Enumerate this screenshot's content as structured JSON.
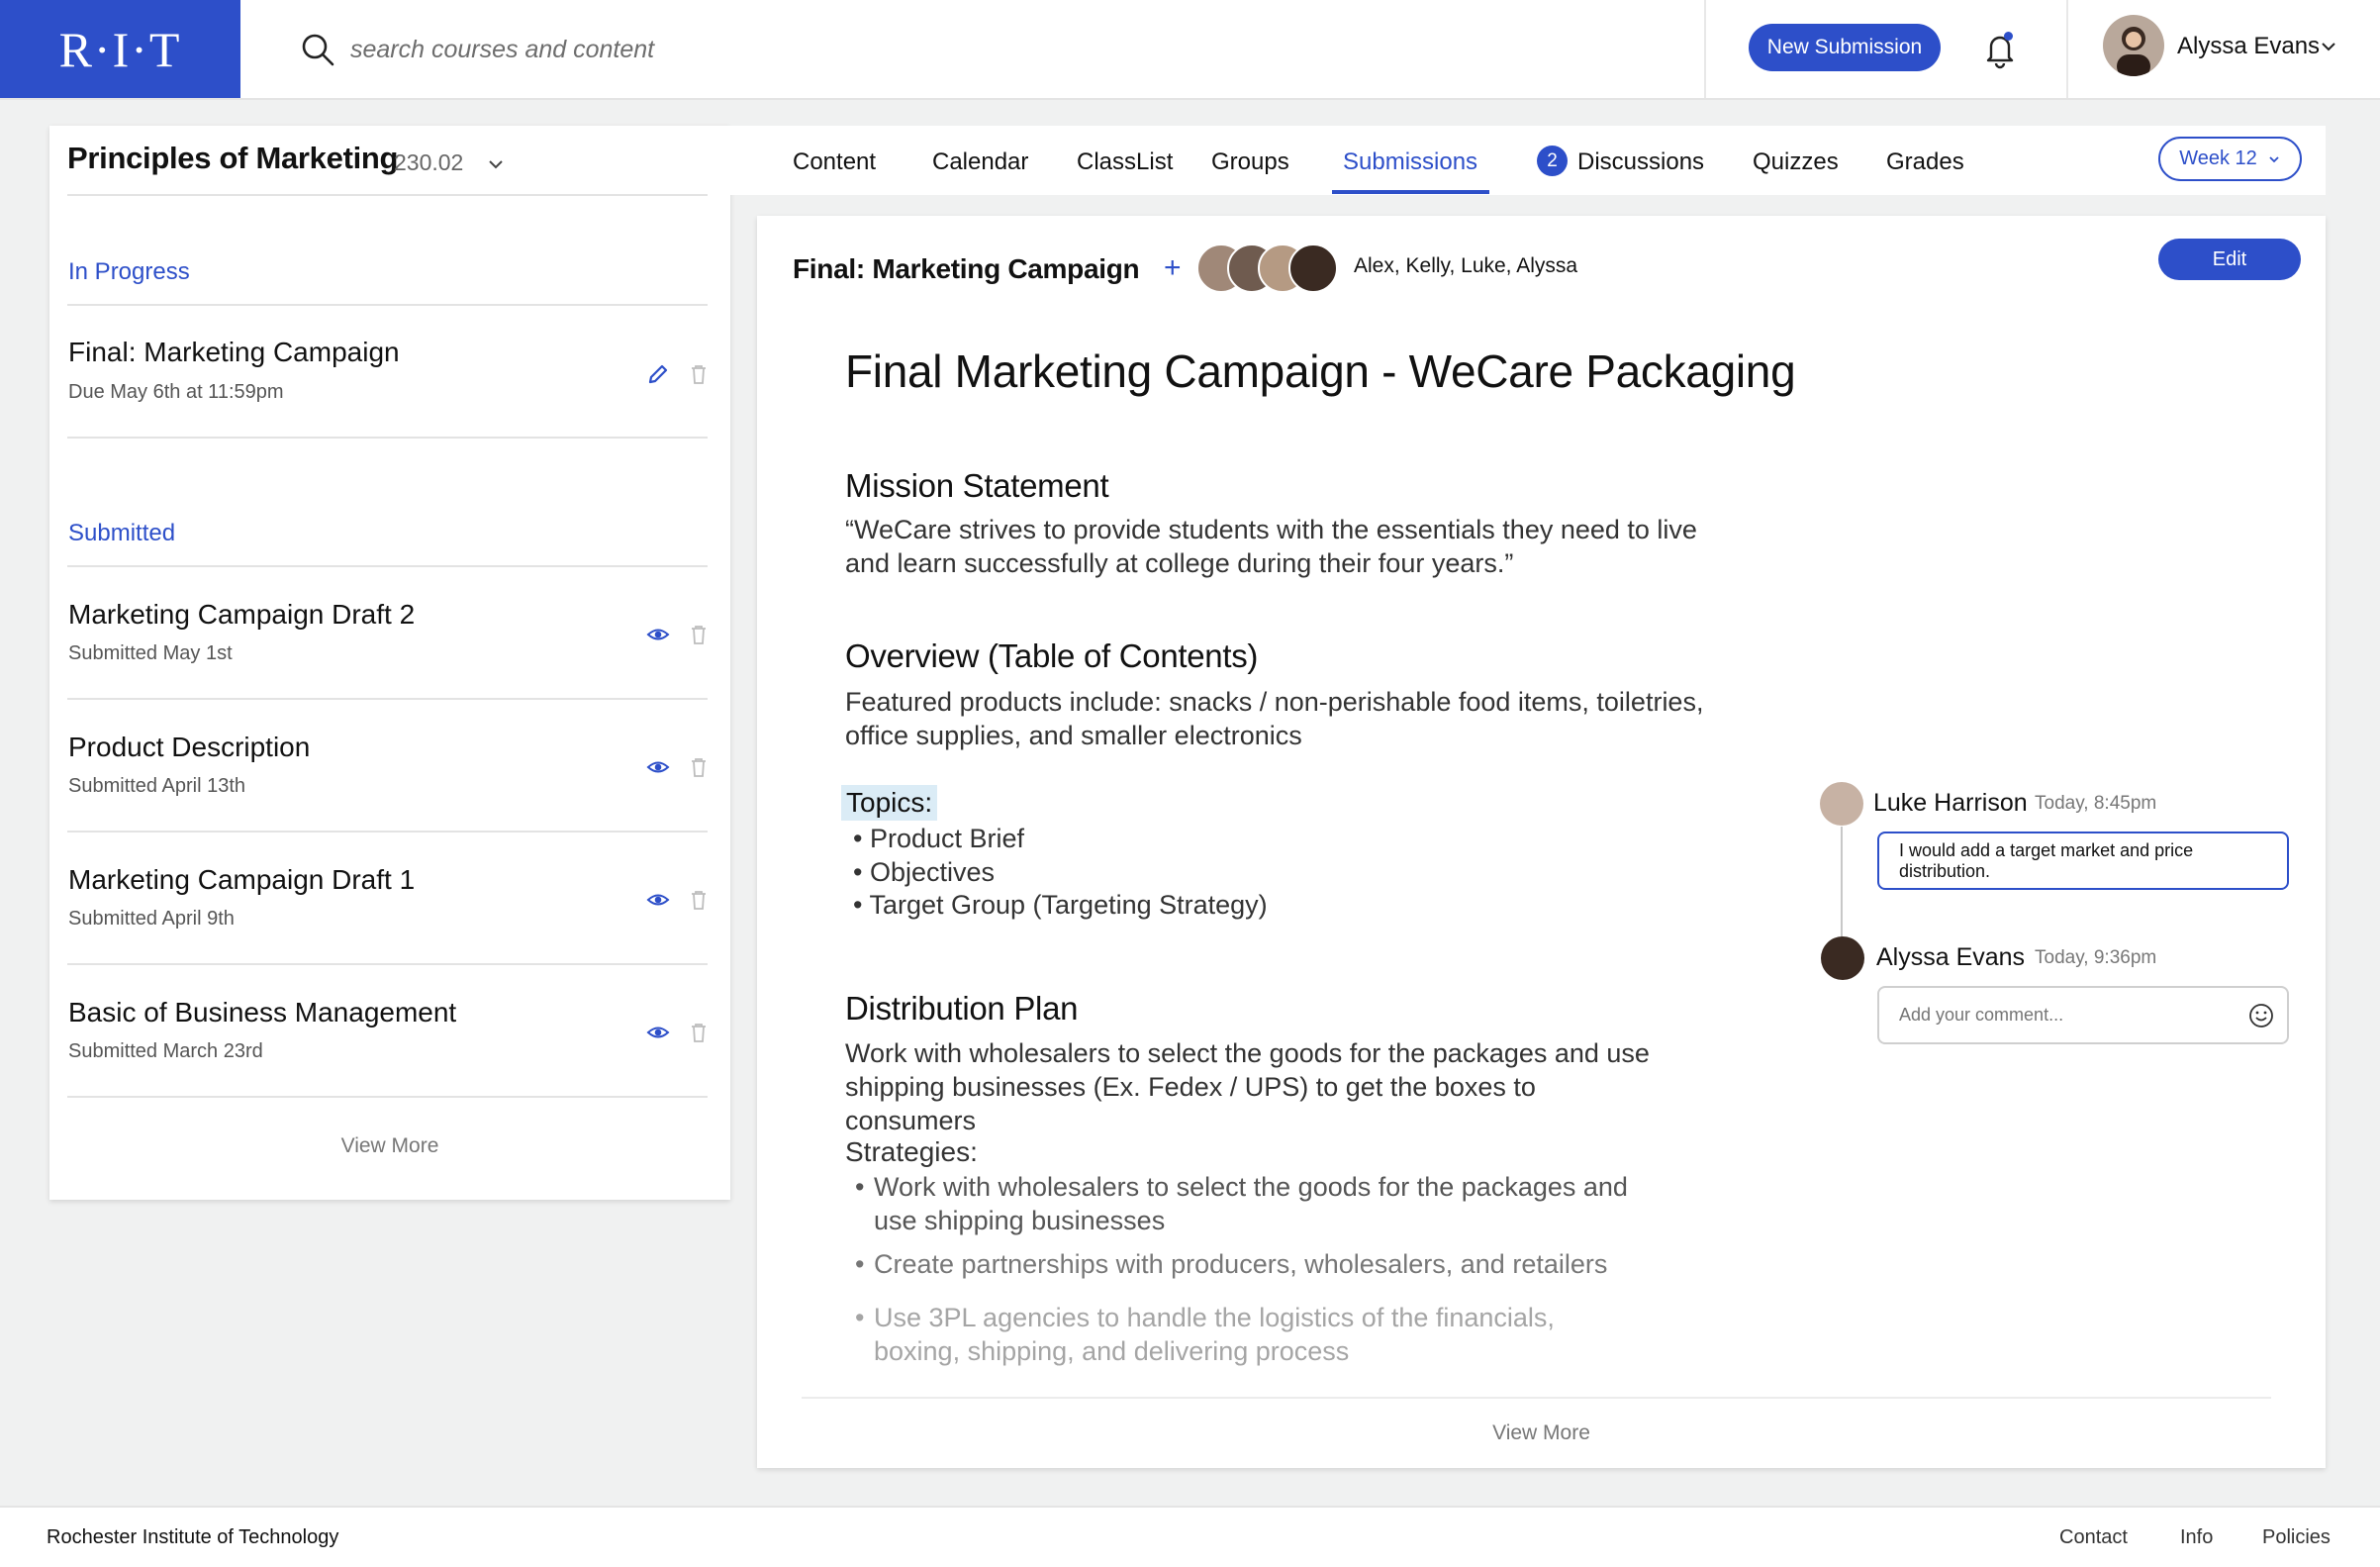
{
  "app": {
    "logo_text": "R·I·T",
    "brand_color": "#2d4fc9"
  },
  "header": {
    "search_placeholder": "search courses and content",
    "new_submission_label": "New Submission",
    "user_name": "Alyssa Evans"
  },
  "course": {
    "title": "Principles of Marketing",
    "number": "230.02"
  },
  "sidebar": {
    "in_progress_label": "In Progress",
    "in_progress_items": [
      {
        "title": "Final: Marketing Campaign",
        "subtitle": "Due May 6th at 11:59pm"
      }
    ],
    "submitted_label": "Submitted",
    "submitted_items": [
      {
        "title": "Marketing Campaign Draft 2",
        "subtitle": "Submitted May 1st"
      },
      {
        "title": "Product Description",
        "subtitle": "Submitted April 13th"
      },
      {
        "title": "Marketing Campaign Draft 1",
        "subtitle": "Submitted April 9th"
      },
      {
        "title": "Basic of Business Management",
        "subtitle": "Submitted March 23rd"
      }
    ],
    "view_more": "View More"
  },
  "tabs": {
    "items": [
      "Content",
      "Calendar",
      "ClassList",
      "Groups",
      "Submissions",
      "Discussions",
      "Quizzes",
      "Grades"
    ],
    "active": "Submissions",
    "discussions_badge": "2",
    "week_label": "Week 12"
  },
  "submission": {
    "title": "Final: Marketing Campaign",
    "members": "Alex, Kelly, Luke, Alyssa",
    "edit_label": "Edit"
  },
  "document": {
    "title": "Final Marketing Campaign - WeCare Packaging",
    "mission_heading": "Mission Statement",
    "mission_text": "“WeCare strives to provide students with the essentials they need to live and learn successfully at college during their four years.”",
    "overview_heading": "Overview (Table of Contents)",
    "overview_text": "Featured products include: snacks / non-perishable food items, toiletries, office supplies, and smaller electronics",
    "topics_label": "Topics:",
    "topics": [
      "Product Brief",
      "Objectives",
      "Target Group (Targeting Strategy)"
    ],
    "distribution_heading": "Distribution Plan",
    "distribution_text": "Work with wholesalers to select the goods for the packages and use shipping businesses (Ex. Fedex / UPS)  to get the boxes to consumers",
    "strategies_label": "Strategies:",
    "strategies": [
      "Work with wholesalers to select the goods for the packages and use shipping businesses",
      "Create partnerships with producers, wholesalers, and retailers",
      "Use 3PL agencies to handle the logistics of the financials, boxing, shipping, and delivering process"
    ],
    "view_more": "View More"
  },
  "comments": {
    "thread": [
      {
        "author": "Luke Harrison",
        "time": "Today, 8:45pm",
        "text": "I would add a target market and price distribution."
      }
    ],
    "reply_author": "Alyssa Evans",
    "reply_time": "Today, 9:36pm",
    "reply_placeholder": "Add your comment..."
  },
  "footer": {
    "org": "Rochester Institute of Technology",
    "links": [
      "Contact",
      "Info",
      "Policies"
    ]
  }
}
